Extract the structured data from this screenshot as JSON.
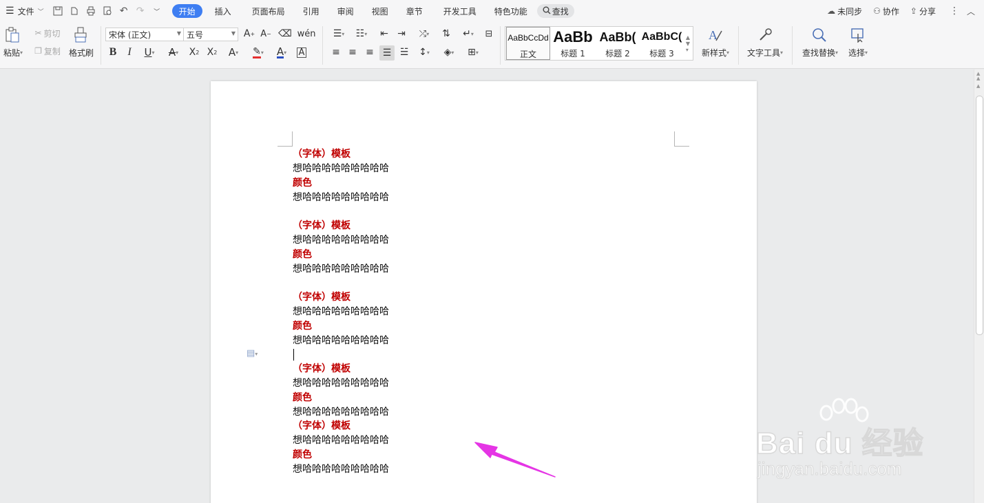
{
  "menubar": {
    "file_label": "文件",
    "tabs": [
      "开始",
      "插入",
      "页面布局",
      "引用",
      "审阅",
      "视图",
      "章节",
      "开发工具",
      "特色功能"
    ],
    "active_tab": "开始",
    "search_label": "查找",
    "sync_label": "未同步",
    "collab_label": "协作",
    "share_label": "分享"
  },
  "ribbon": {
    "paste": "粘贴",
    "cut": "剪切",
    "copy": "复制",
    "format_painter": "格式刷",
    "font_name": "宋体 (正文)",
    "font_size": "五号",
    "styles": [
      {
        "sample": "AaBbCcDd",
        "label": "正文"
      },
      {
        "sample": "AaBb",
        "label": "标题 1"
      },
      {
        "sample": "AaBb(",
        "label": "标题 2"
      },
      {
        "sample": "AaBbC(",
        "label": "标题 3"
      }
    ],
    "new_style": "新样式",
    "text_tools": "文字工具",
    "find_replace": "查找替换",
    "select": "选择"
  },
  "document": {
    "lines": [
      {
        "text": "（字体）模板",
        "style": "red"
      },
      {
        "text": "想哈哈哈哈哈哈哈哈哈",
        "style": "normal"
      },
      {
        "text": "颜色",
        "style": "red"
      },
      {
        "text": "想哈哈哈哈哈哈哈哈哈",
        "style": "normal"
      },
      {
        "text": "（字体）模板",
        "style": "red"
      },
      {
        "text": "想哈哈哈哈哈哈哈哈哈",
        "style": "normal"
      },
      {
        "text": "颜色",
        "style": "red"
      },
      {
        "text": "想哈哈哈哈哈哈哈哈哈",
        "style": "normal"
      },
      {
        "text": "（字体）模板",
        "style": "red"
      },
      {
        "text": "想哈哈哈哈哈哈哈哈哈",
        "style": "normal"
      },
      {
        "text": "颜色",
        "style": "red"
      },
      {
        "text": "想哈哈哈哈哈哈哈哈哈",
        "style": "normal"
      },
      {
        "text": "（字体）模板",
        "style": "red"
      },
      {
        "text": "想哈哈哈哈哈哈哈哈哈",
        "style": "normal"
      },
      {
        "text": "颜色",
        "style": "red"
      },
      {
        "text": "想哈哈哈哈哈哈哈哈哈",
        "style": "normal"
      },
      {
        "text": "（字体）模板",
        "style": "red"
      },
      {
        "text": "想哈哈哈哈哈哈哈哈哈",
        "style": "normal"
      },
      {
        "text": "颜色",
        "style": "red"
      },
      {
        "text": "想哈哈哈哈哈哈哈哈哈",
        "style": "normal"
      }
    ]
  },
  "watermark": {
    "brand": "Bai du 经验",
    "url": "jingyan.baidu.com"
  },
  "colors": {
    "accent": "#3e7ef2",
    "heading_red": "#c00000",
    "annotation_arrow": "#e535e5"
  }
}
